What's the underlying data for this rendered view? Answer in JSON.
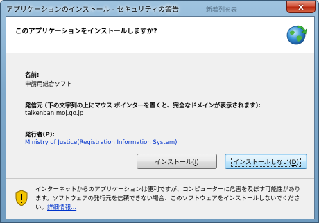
{
  "window": {
    "title": "アプリケーションのインストール - セキュリティの警告",
    "close_symbol": "x",
    "background_text": "新着列を表"
  },
  "header": {
    "question": "このアプリケーションをインストールしますか?"
  },
  "fields": {
    "name_label": "名前:",
    "name_value": "申請用総合ソフト",
    "origin_label": "発信元 (下の文字列の上にマウス ポインターを置くと、完全なドメインが表示されます):",
    "origin_value": "taikenban.moj.go.jp",
    "publisher_label": "発行者(P):",
    "publisher_link": "Ministry of Justice(Registration Information System)"
  },
  "buttons": {
    "install_prefix": "インストール(",
    "install_key": "I",
    "install_suffix": ")",
    "dont_install_prefix": "インストールしない(",
    "dont_install_key": "D",
    "dont_install_suffix": ")"
  },
  "warning": {
    "line1": "インターネットからのアプリケーションは便利ですが、コンピューターに危害を及ぼす可能性があり",
    "line2": "ます。ソフトウェアの発行元を信頼できない場合、このソフトウェアをインストールしないでくださ",
    "line3_prefix": "い。",
    "more_info_link": "詳細情報...",
    "shield_color": "#e8b400"
  }
}
